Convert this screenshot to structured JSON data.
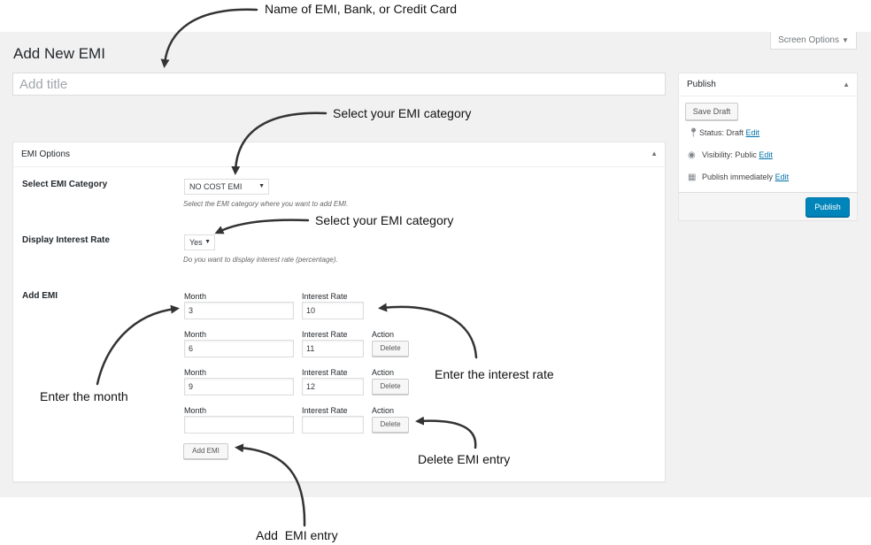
{
  "header": {
    "screen_options": "Screen Options",
    "page_title": "Add New EMI",
    "title_placeholder": "Add title"
  },
  "emi_box": {
    "title": "EMI Options",
    "category": {
      "label": "Select EMI Category",
      "selected": "NO COST EMI",
      "description": "Select the EMI category where you want to add EMI."
    },
    "interest": {
      "label": "Display Interest Rate",
      "selected": "Yes",
      "description": "Do you want to display interest rate (percentage)."
    },
    "add_emi": {
      "label": "Add EMI",
      "month_label": "Month",
      "rate_label": "Interest Rate",
      "action_label": "Action",
      "delete_label": "Delete",
      "add_button": "Add EMI",
      "rows": [
        {
          "month": "3",
          "rate": "10"
        },
        {
          "month": "6",
          "rate": "11"
        },
        {
          "month": "9",
          "rate": "12"
        },
        {
          "month": "",
          "rate": ""
        }
      ]
    }
  },
  "publish": {
    "title": "Publish",
    "save_draft": "Save Draft",
    "status_label": "Status: Draft",
    "visibility_label": "Visibility: Public",
    "schedule_label": "Publish immediately",
    "edit_link": "Edit",
    "publish_button": "Publish"
  },
  "annotations": {
    "name": "Name of EMI, Bank, or Credit Card",
    "category": "Select your EMI category",
    "category2": "Select your EMI category",
    "month": "Enter the month",
    "rate": "Enter the interest rate",
    "delete": "Delete EMI entry",
    "add": "Add  EMI entry"
  },
  "colors": {
    "primary": "#0085ba",
    "link": "#0073aa",
    "admin_bg": "#f1f1f1"
  }
}
